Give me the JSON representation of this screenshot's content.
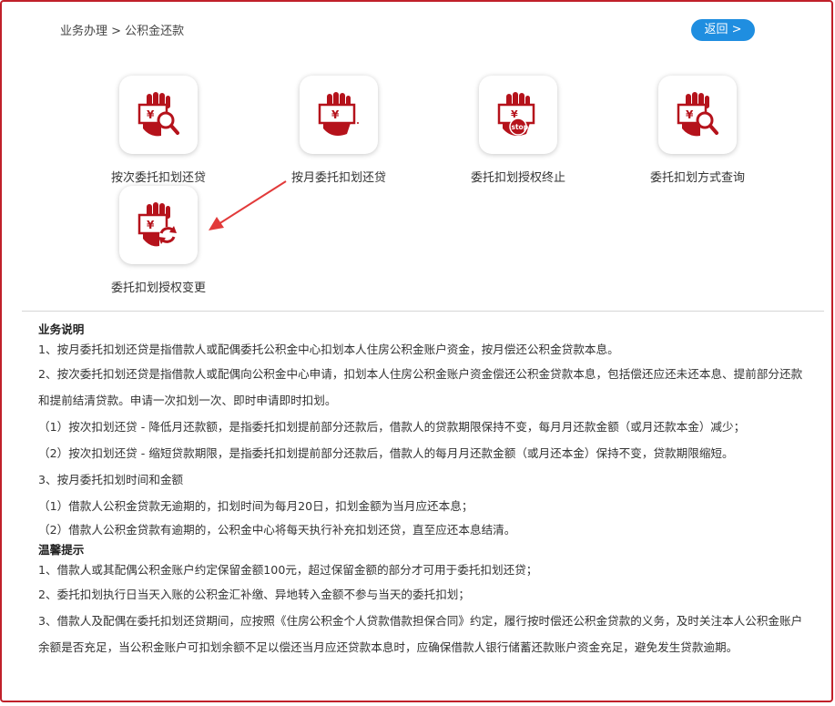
{
  "breadcrumb": {
    "text": "业务办理 > 公积金还款"
  },
  "header": {
    "back_label": "返回 >"
  },
  "colors": {
    "accent": "#1f8ee0",
    "icon_red": "#b5121b",
    "frame": "#c0202a",
    "arrow": "#e23a3a"
  },
  "tiles": [
    {
      "label": "按次委托扣划还贷",
      "icon": "hand-magnify-icon"
    },
    {
      "label": "按月委托扣划还贷",
      "icon": "hand-banknote-icon"
    },
    {
      "label": "委托扣划授权终止",
      "icon": "hand-stop-icon"
    },
    {
      "label": "委托扣划方式查询",
      "icon": "hand-query-icon"
    },
    {
      "label": "委托扣划授权变更",
      "icon": "hand-refresh-icon"
    }
  ],
  "business": {
    "title": "业务说明",
    "p1": "1、按月委托扣划还贷是指借款人或配偶委托公积金中心扣划本人住房公积金账户资金，按月偿还公积金贷款本息。",
    "p2": "2、按次委托扣划还贷是指借款人或配偶向公积金中心申请，扣划本人住房公积金账户资金偿还公积金贷款本息，包括偿还应还未还本息、提前部分还款和提前结清贷款。申请一次扣划一次、即时申请即时扣划。",
    "p3": "（1）按次扣划还贷 - 降低月还款额，是指委托扣划提前部分还款后，借款人的贷款期限保持不变，每月月还款金额（或月还款本金）减少；",
    "p4": "（2）按次扣划还贷 - 缩短贷款期限，是指委托扣划提前部分还款后，借款人的每月月还款金额（或月还本金）保持不变，贷款期限缩短。",
    "p5": "3、按月委托扣划时间和金额",
    "p6": "（1）借款人公积金贷款无逾期的，扣划时间为每月20日，扣划金额为当月应还本息；",
    "p7": "（2）借款人公积金贷款有逾期的，公积金中心将每天执行补充扣划还贷，直至应还本息结清。"
  },
  "tips": {
    "title": "温馨提示",
    "t1": "1、借款人或其配偶公积金账户约定保留金额100元，超过保留金额的部分才可用于委托扣划还贷；",
    "t2": "2、委托扣划执行日当天入账的公积金汇补缴、异地转入金额不参与当天的委托扣划；",
    "t3": "3、借款人及配偶在委托扣划还贷期间，应按照《住房公积金个人贷款借款担保合同》约定，履行按时偿还公积金贷款的义务，及时关注本人公积金账户余额是否充足，当公积金账户可扣划余额不足以偿还当月应还贷款本息时，应确保借款人银行储蓄还款账户资金充足，避免发生贷款逾期。"
  }
}
